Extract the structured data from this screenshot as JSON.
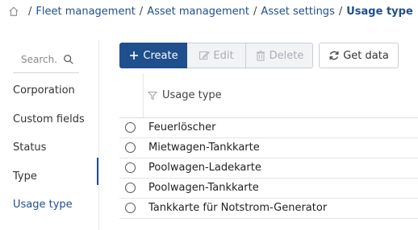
{
  "breadcrumb": {
    "items": [
      "Fleet management",
      "Asset management",
      "Asset settings"
    ],
    "current": "Usage type",
    "separator": "/"
  },
  "sidebar": {
    "search_placeholder": "Search...",
    "items": [
      {
        "label": "Corporation"
      },
      {
        "label": "Custom fields"
      },
      {
        "label": "Status"
      },
      {
        "label": "Type"
      },
      {
        "label": "Usage type"
      }
    ],
    "active": "Usage type"
  },
  "toolbar": {
    "create_label": "Create",
    "edit_label": "Edit",
    "delete_label": "Delete",
    "getdata_label": "Get data"
  },
  "table": {
    "header": "Usage type",
    "rows": [
      "Feuerlöscher",
      "Mietwagen-Tankkarte",
      "Poolwagen-Ladekarte",
      "Poolwagen-Tankkarte",
      "Tankkarte für Notstrom-Generator"
    ]
  },
  "colors": {
    "accent": "#1f4f8c",
    "disabled_text": "#a9afb7",
    "border": "#c8ced6"
  },
  "icons": {
    "home": "home-icon",
    "search": "search-icon",
    "create": "plus-icon",
    "edit": "pencil-icon",
    "delete": "trash-icon",
    "getdata": "refresh-icon",
    "filter": "filter-icon"
  }
}
